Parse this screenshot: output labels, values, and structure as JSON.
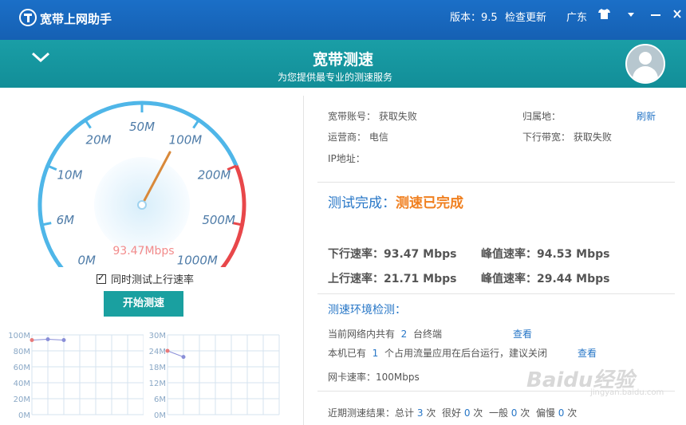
{
  "titlebar": {
    "app_name": "宽带上网助手",
    "version": "版本：9.5",
    "check_update": "检查更新",
    "region": "广东",
    "skin_icon": "tshirt-icon",
    "menu_icon": "dropdown-icon",
    "minimize_icon": "minimize-icon"
  },
  "banner": {
    "title": "宽带测速",
    "subtitle": "为您提供最专业的测速服务",
    "collapse_icon": "chevron-down-icon"
  },
  "gauge": {
    "labels": [
      "0M",
      "6M",
      "10M",
      "20M",
      "50M",
      "100M",
      "200M",
      "500M",
      "1000M"
    ],
    "current_speed": "93.47Mbps",
    "accent": "#4fb6e8",
    "danger": "#e8474a"
  },
  "controls": {
    "upload_test_label": "同时测试上行速率",
    "upload_test_checked": true,
    "start_button": "开始测速"
  },
  "mini_chart_down": {
    "yticks": [
      "100M",
      "80M",
      "60M",
      "40M",
      "20M",
      "0M"
    ],
    "points": [
      93.47,
      94.53,
      93.47
    ]
  },
  "mini_chart_up": {
    "yticks": [
      "30M",
      "24M",
      "18M",
      "12M",
      "6M",
      "0M"
    ],
    "points": [
      24,
      21.71
    ]
  },
  "account": {
    "account_label": "宽带账号：",
    "account_value": "获取失败",
    "location_label": "归属地：",
    "refresh": "刷新",
    "isp_label": "运营商：",
    "isp_value": "电信",
    "downlink_label": "下行带宽：",
    "downlink_value": "获取失败",
    "ip_label": "IP地址："
  },
  "result": {
    "label": "测试完成：",
    "status": "测速已完成",
    "down_label": "下行速率：",
    "down_value": "93.47 Mbps",
    "peak_label": "峰值速率：",
    "peak_down_value": "94.53 Mbps",
    "up_label": "上行速率：",
    "up_value": "21.71 Mbps",
    "peak_up_value": "29.44 Mbps"
  },
  "environment": {
    "title": "测速环境检测：",
    "devices_prefix": "当前网络内共有",
    "devices_count": "2",
    "devices_suffix": "台终端",
    "view": "查看",
    "apps_prefix": "本机已有",
    "apps_count": "1",
    "apps_suffix": "个占用流量应用在后台运行，建议关闭",
    "nic_label": "网卡速率：",
    "nic_value": "100Mbps"
  },
  "history": {
    "prefix": "近期测速结果：总计",
    "total": "3",
    "unit": "次",
    "good_label": "很好",
    "good": "0",
    "fair_label": "一般",
    "fair": "0",
    "poor_label": "偏慢",
    "poor": "0"
  },
  "watermark": {
    "text": "Baidu经验",
    "sub": "jingyan.baidu.com"
  }
}
